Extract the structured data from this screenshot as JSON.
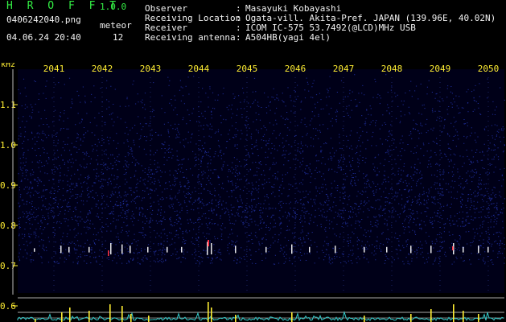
{
  "header": {
    "app_title": "H R O F F T",
    "version": "1.0.0",
    "filename": "0406242040.png",
    "meteor_label": "meteor",
    "datetime": "04.06.24 20:40",
    "meteor_count": "12",
    "info": [
      {
        "label": "Observer",
        "value": "Masayuki Kobayashi"
      },
      {
        "label": "Receiving Location",
        "value": "Ogata-vill. Akita-Pref. JAPAN (139.96E, 40.02N)"
      },
      {
        "label": "Receiver",
        "value": "ICOM IC-575 53.7492(@LCD)MHz USB"
      },
      {
        "label": "Receiving antenna",
        "value": "A504HB(yagi 4el)"
      }
    ]
  },
  "chart_data": {
    "type": "heatmap",
    "ylabel": "kHz",
    "x_ticks": [
      "2041",
      "2042",
      "2043",
      "2044",
      "2045",
      "2046",
      "2047",
      "2048",
      "2049",
      "2050"
    ],
    "y_ticks": [
      {
        "value": 1.1,
        "label": "1.1"
      },
      {
        "value": 1.0,
        "label": "1.0"
      },
      {
        "value": 0.9,
        "label": "0.9"
      },
      {
        "value": 0.8,
        "label": "0.8"
      },
      {
        "value": 0.7,
        "label": "0.7"
      },
      {
        "value": 0.6,
        "label": "0.6"
      }
    ],
    "ylim": [
      0.58,
      1.2
    ],
    "grid": true,
    "colors": {
      "background": "#000018",
      "noise": "#2233aa",
      "echo": "#ffffff",
      "strong_echo": "#ff3344",
      "axis_text": "#ffee33",
      "level_bar": "#ffee33",
      "level_trace": "#33cccc"
    }
  }
}
